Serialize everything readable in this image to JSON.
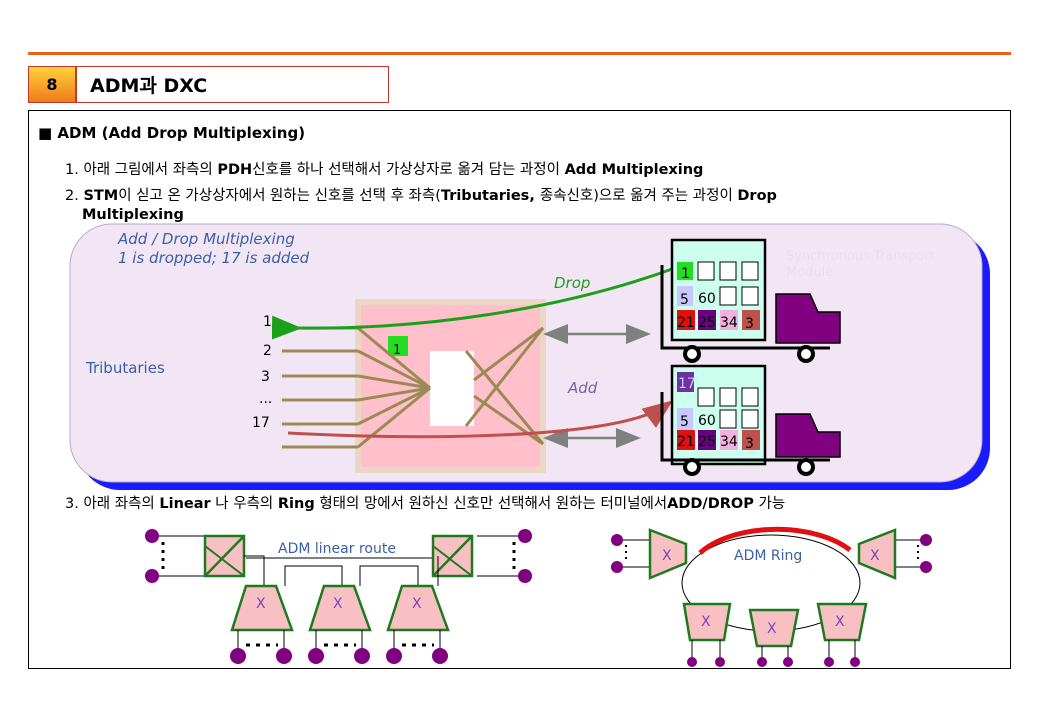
{
  "header": {
    "number": "8",
    "title": "ADM과 DXC"
  },
  "section": {
    "heading": "■ ADM (Add Drop Multiplexing)"
  },
  "items": [
    {
      "prefix": "1. ",
      "text_a": "아래 그림에서 좌측의 ",
      "bold_a": "PDH",
      "text_b": "신호를 하나 선택해서 가상상자로 옮겨 담는 과정이 ",
      "bold_b": "Add Multiplexing"
    },
    {
      "prefix": "2. ",
      "bold_a": "STM",
      "text_a": "이 싣고 온 가상상자에서 원하는 신호를 선택 후 좌측(",
      "bold_b": "Tributaries, ",
      "text_b": "종속신호)으로 옮겨 주는 과정이 ",
      "bold_c": "Drop",
      "line2": "Multiplexing"
    },
    {
      "prefix": "3. ",
      "text_a": "아래 좌측의 ",
      "bold_a": "Linear",
      "text_b": " 나 우측의 ",
      "bold_b": "Ring",
      "text_c": " 형태의 망에서 원하신 신호만 선택해서 원하는 터미널에서",
      "bold_c": "ADD/DROP",
      "text_d": " 가능"
    }
  ],
  "diagram": {
    "caption_line1": "Add / Drop Multiplexing",
    "caption_line2": "1 is dropped; 17 is added",
    "tributaries_label": "Tributaries",
    "trib_numbers": [
      "1",
      "2",
      "3",
      "...",
      "17"
    ],
    "selected_box": "1",
    "drop_label": "Drop",
    "add_label": "Add",
    "truck_label_line1": "Synchronous Transport",
    "truck_label_line2": "Module",
    "truck1_cells": [
      "1",
      "5",
      "60",
      "21",
      "25",
      "34",
      "3"
    ],
    "truck2_cells": [
      "17",
      "5",
      "60",
      "21",
      "25",
      "34",
      "3"
    ],
    "colors": {
      "drop": "#1aa01a",
      "add": "#c0504d",
      "mux": "#ffc0cb",
      "truck": "#800080",
      "panel": "#f2e6f5"
    }
  },
  "linear": {
    "label": "ADM linear route",
    "node_labels": [
      "X",
      "X",
      "X"
    ]
  },
  "ring": {
    "label": "ADM Ring",
    "node_labels": [
      "X",
      "X",
      "X",
      "X",
      "X"
    ]
  }
}
